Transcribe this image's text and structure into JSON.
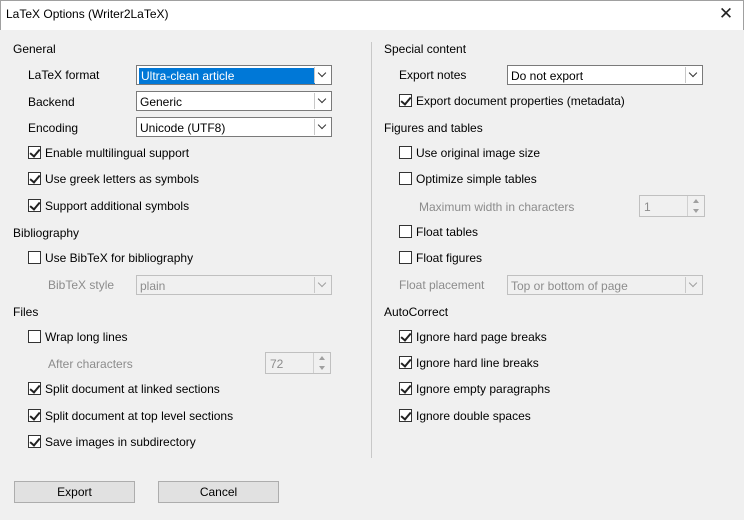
{
  "window": {
    "title": "LaTeX Options (Writer2LaTeX)",
    "close_glyph": "✕"
  },
  "general": {
    "heading": "General",
    "latex_format": {
      "label": "LaTeX format",
      "value": "Ultra-clean article"
    },
    "backend": {
      "label": "Backend",
      "value": "Generic"
    },
    "encoding": {
      "label": "Encoding",
      "value": "Unicode (UTF8)"
    },
    "multilingual": {
      "label": "Enable multilingual support",
      "checked": true
    },
    "greek": {
      "label": "Use greek letters as symbols",
      "checked": true
    },
    "additional_symbols": {
      "label": "Support additional symbols",
      "checked": true
    }
  },
  "bibliography": {
    "heading": "Bibliography",
    "use_bibtex": {
      "label": "Use BibTeX for bibliography",
      "checked": false
    },
    "bibtex_style": {
      "label": "BibTeX style",
      "value": "plain"
    }
  },
  "files": {
    "heading": "Files",
    "wrap_lines": {
      "label": "Wrap long lines",
      "checked": false
    },
    "after_characters": {
      "label": "After characters",
      "value": "72"
    },
    "split_linked": {
      "label": "Split document at linked sections",
      "checked": true
    },
    "split_top": {
      "label": "Split document at top level sections",
      "checked": true
    },
    "save_images": {
      "label": "Save images in subdirectory",
      "checked": true
    }
  },
  "special_content": {
    "heading": "Special content",
    "export_notes": {
      "label": "Export notes",
      "value": "Do not export"
    },
    "export_properties": {
      "label": "Export document properties (metadata)",
      "checked": true
    }
  },
  "figures_tables": {
    "heading": "Figures and tables",
    "original_size": {
      "label": "Use original image size",
      "checked": false
    },
    "optimize_tables": {
      "label": "Optimize simple tables",
      "checked": false
    },
    "max_width": {
      "label": "Maximum width in characters",
      "value": "1"
    },
    "float_tables": {
      "label": "Float tables",
      "checked": false
    },
    "float_figures": {
      "label": "Float figures",
      "checked": false
    },
    "float_placement": {
      "label": "Float placement",
      "value": "Top or bottom of page"
    }
  },
  "autocorrect": {
    "heading": "AutoCorrect",
    "hard_page_breaks": {
      "label": "Ignore hard page breaks",
      "checked": true
    },
    "hard_line_breaks": {
      "label": "Ignore hard line breaks",
      "checked": true
    },
    "empty_paragraphs": {
      "label": "Ignore empty paragraphs",
      "checked": true
    },
    "double_spaces": {
      "label": "Ignore double spaces",
      "checked": true
    }
  },
  "buttons": {
    "export": "Export",
    "cancel": "Cancel"
  }
}
